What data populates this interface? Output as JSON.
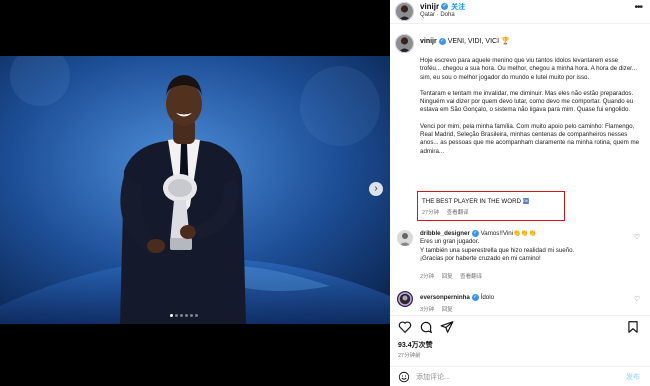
{
  "post": {
    "username": "vinijr",
    "follow_label": "关注",
    "location": "Qatar · Doha"
  },
  "caption": {
    "username": "vinijr",
    "title": "VENI, VIDI, VICI 🏆",
    "paragraphs": [
      "Hoje escrevo para aquele menino que viu tantos ídolos levantarem esse troféu... chegou a sua hora. Ou melhor, chegou a minha hora. A hora de dizer... sim, eu sou o melhor jogador do mundo e lutei muito por isso.",
      "Tentaram e tentam me invalidar, me diminuir. Mas eles não estão preparados. Ninguém vai dizer por quem devo lutar, como devo me comportar. Quando eu estava em São Gonçalo, o sistema não ligava para mim. Quase fui engolido.",
      "Venci por mim, pela minha família. Com muito apoio pelo caminho: Flamengo, Real Madrid, Seleção Brasileira, minhas centenas de companheiros nesses anos... as pessoas que me acompanham claramente na minha rotina, quem me admira..."
    ],
    "highlight": "THE BEST PLAYER IN THE WORD",
    "highlight_badge": "OK",
    "time": "27分钟",
    "translate": "查看翻译"
  },
  "comments": [
    {
      "username": "dribble_designer",
      "lines": [
        "Vamos!!Vini👏👏👏",
        "Eres un gran jugador.",
        "Y también una superestrella que hizo realidad mi sueño.",
        "¡Gracias por haberte cruzado en mi camino!"
      ],
      "time": "2分钟",
      "reply": "回复",
      "translate": "查看翻译"
    },
    {
      "username": "eversonperninha",
      "lines": [
        "Ídolo"
      ],
      "time": "3分钟",
      "reply": "回复"
    }
  ],
  "footer": {
    "likes": "93.4万次赞",
    "time": "27分钟前",
    "comment_placeholder": "添加评论...",
    "post_label": "发布"
  },
  "icons": [
    "more-icon",
    "heart-icon",
    "comment-icon",
    "share-icon",
    "bookmark-icon",
    "emoji-icon",
    "chevron-right-icon",
    "verified-icon"
  ],
  "colors": {
    "accent": "#0095f6",
    "highlight_border": "#d0161b",
    "verified": "#3797f0"
  }
}
